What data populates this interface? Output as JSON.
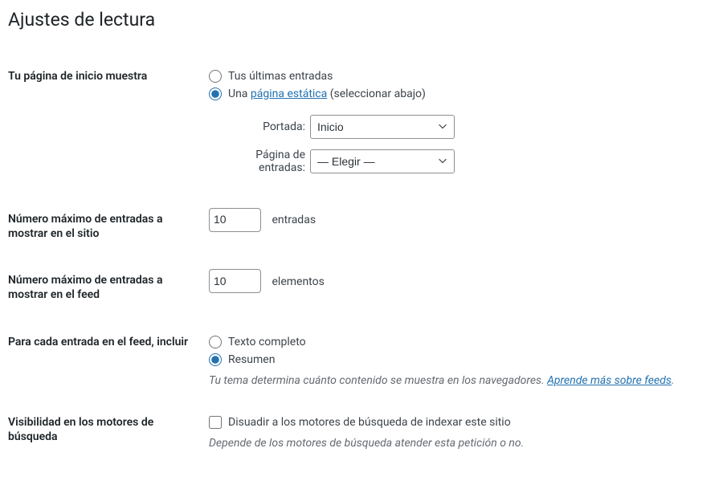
{
  "page_title": "Ajustes de lectura",
  "homepage": {
    "label": "Tu página de inicio muestra",
    "option_latest": "Tus últimas entradas",
    "option_static_prefix": "Una ",
    "option_static_link": "página estática",
    "option_static_suffix": " (seleccionar abajo)",
    "front_label": "Portada:",
    "front_value": "Inicio",
    "posts_label": "Página de entradas:",
    "posts_value": "— Elegir —"
  },
  "posts_per_page": {
    "label": "Número máximo de entradas a mostrar en el sitio",
    "value": "10",
    "suffix": "entradas"
  },
  "posts_per_feed": {
    "label": "Número máximo de entradas a mostrar en el feed",
    "value": "10",
    "suffix": "elementos"
  },
  "feed_content": {
    "label": "Para cada entrada en el feed, incluir",
    "option_full": "Texto completo",
    "option_summary": "Resumen",
    "desc_text": "Tu tema determina cuánto contenido se muestra en los navegadores. ",
    "desc_link": "Aprende más sobre feeds",
    "desc_period": "."
  },
  "search_visibility": {
    "label": "Visibilidad en los motores de búsqueda",
    "checkbox_label": "Disuadir a los motores de búsqueda de indexar este sitio",
    "desc": "Depende de los motores de búsqueda atender esta petición o no."
  }
}
